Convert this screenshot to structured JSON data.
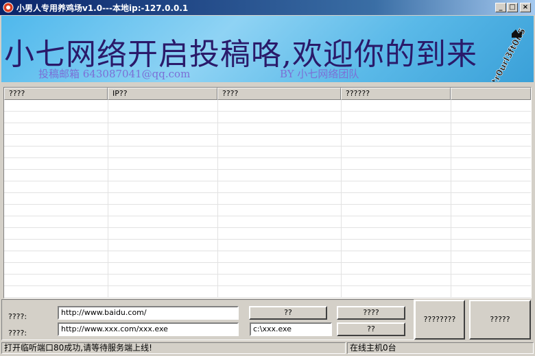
{
  "window": {
    "title": "小男人专用养鸡场v1.0---本地ip:-127.0.0.1",
    "minimize_glyph": "_",
    "maximize_glyph": "□",
    "close_glyph": "×"
  },
  "banner": {
    "title": "小七网络开启投稿咯,欢迎你的到来",
    "email": "投稿邮箱 643087041@qq.com",
    "team": "BY 小七网络团队",
    "logo_text": "tr0url3ft0n5"
  },
  "list": {
    "columns": [
      "????",
      "IP??",
      "????",
      "??????",
      ""
    ],
    "rows": []
  },
  "form": {
    "url_label": "????:",
    "url_value": "http://www.baidu.com/",
    "download_label": "????:",
    "download_value": "http://www.xxx.com/xxx.exe",
    "path_value": "c:\\xxx.exe",
    "button_open": "??",
    "button_run": "??",
    "button_top": "????",
    "button_bottom": "??",
    "big_button_1": "????????",
    "big_button_2": "?????"
  },
  "status": {
    "message": "打开临听端口80成功,请等待服务端上线!",
    "online": "在线主机0台"
  },
  "colors": {
    "titlebar_start": "#0a246a",
    "banner_text": "#2a1a6a",
    "banner_subtext": "#7b6fd6"
  }
}
